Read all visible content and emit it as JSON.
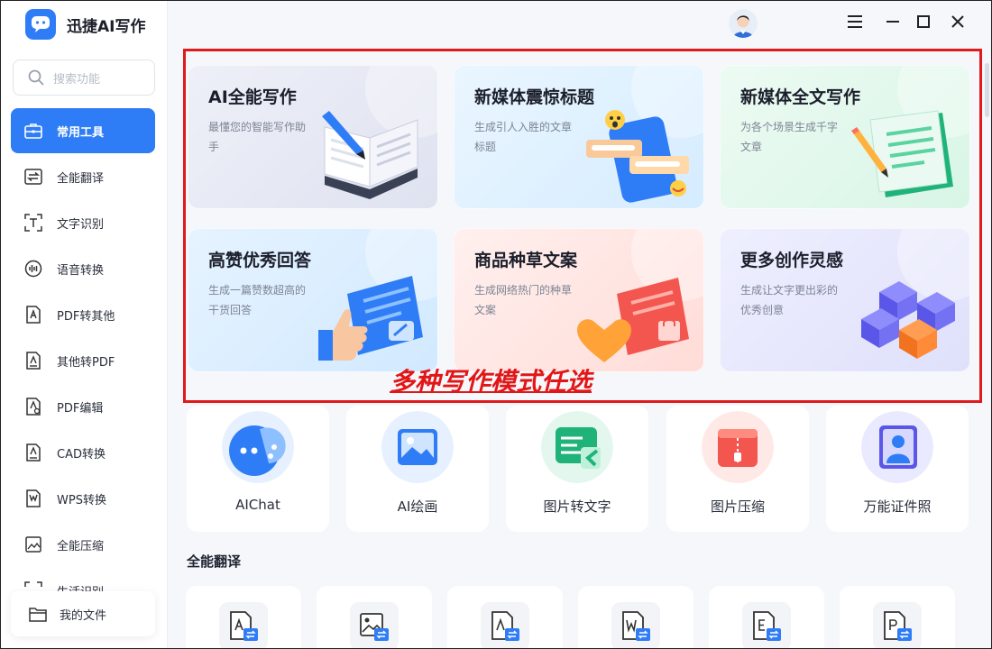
{
  "app": {
    "title": "迅捷AI写作"
  },
  "search": {
    "placeholder": "搜索功能"
  },
  "sidebar": {
    "items": [
      {
        "label": "常用工具",
        "icon": "toolbox-icon",
        "active": true
      },
      {
        "label": "全能翻译",
        "icon": "translate-icon"
      },
      {
        "label": "文字识别",
        "icon": "text-ocr-icon"
      },
      {
        "label": "语音转换",
        "icon": "voice-icon"
      },
      {
        "label": "PDF转其他",
        "icon": "pdf-convert-icon"
      },
      {
        "label": "其他转PDF",
        "icon": "to-pdf-icon"
      },
      {
        "label": "PDF编辑",
        "icon": "pdf-edit-icon"
      },
      {
        "label": "CAD转换",
        "icon": "cad-icon"
      },
      {
        "label": "WPS转换",
        "icon": "wps-icon"
      },
      {
        "label": "全能压缩",
        "icon": "compress-icon"
      },
      {
        "label": "生活识别",
        "icon": "scan-icon"
      }
    ],
    "my_files": "我的文件"
  },
  "writing_cards": [
    {
      "title": "AI全能写作",
      "desc": "最懂您的智能写作助手"
    },
    {
      "title": "新媒体震惊标题",
      "desc": "生成引人入胜的文章标题"
    },
    {
      "title": "新媒体全文写作",
      "desc": "为各个场景生成千字文章"
    },
    {
      "title": "高赞优秀回答",
      "desc": "生成一篇赞数超高的干货回答"
    },
    {
      "title": "商品种草文案",
      "desc": "生成网络热门的种草文案"
    },
    {
      "title": "更多创作灵感",
      "desc": "生成让文字更出彩的优秀创意"
    }
  ],
  "annotation": "多种写作模式任选",
  "tools": [
    {
      "label": "AIChat",
      "icon": "chat-bubble-icon"
    },
    {
      "label": "AI绘画",
      "icon": "picture-icon"
    },
    {
      "label": "图片转文字",
      "icon": "image-to-text-icon"
    },
    {
      "label": "图片压缩",
      "icon": "zip-icon"
    },
    {
      "label": "万能证件照",
      "icon": "id-photo-icon"
    }
  ],
  "section": {
    "title": "全能翻译"
  },
  "translate_tools": [
    {
      "letter": "A",
      "icon": "doc-translate-icon"
    },
    {
      "letter": "",
      "icon": "image-translate-icon"
    },
    {
      "letter": "A",
      "icon": "pdf-translate-icon"
    },
    {
      "letter": "W",
      "icon": "word-translate-icon"
    },
    {
      "letter": "E",
      "icon": "excel-translate-icon"
    },
    {
      "letter": "P",
      "icon": "ppt-translate-icon"
    }
  ],
  "colors": {
    "accent": "#2f7df6",
    "highlight": "#e0191b"
  }
}
